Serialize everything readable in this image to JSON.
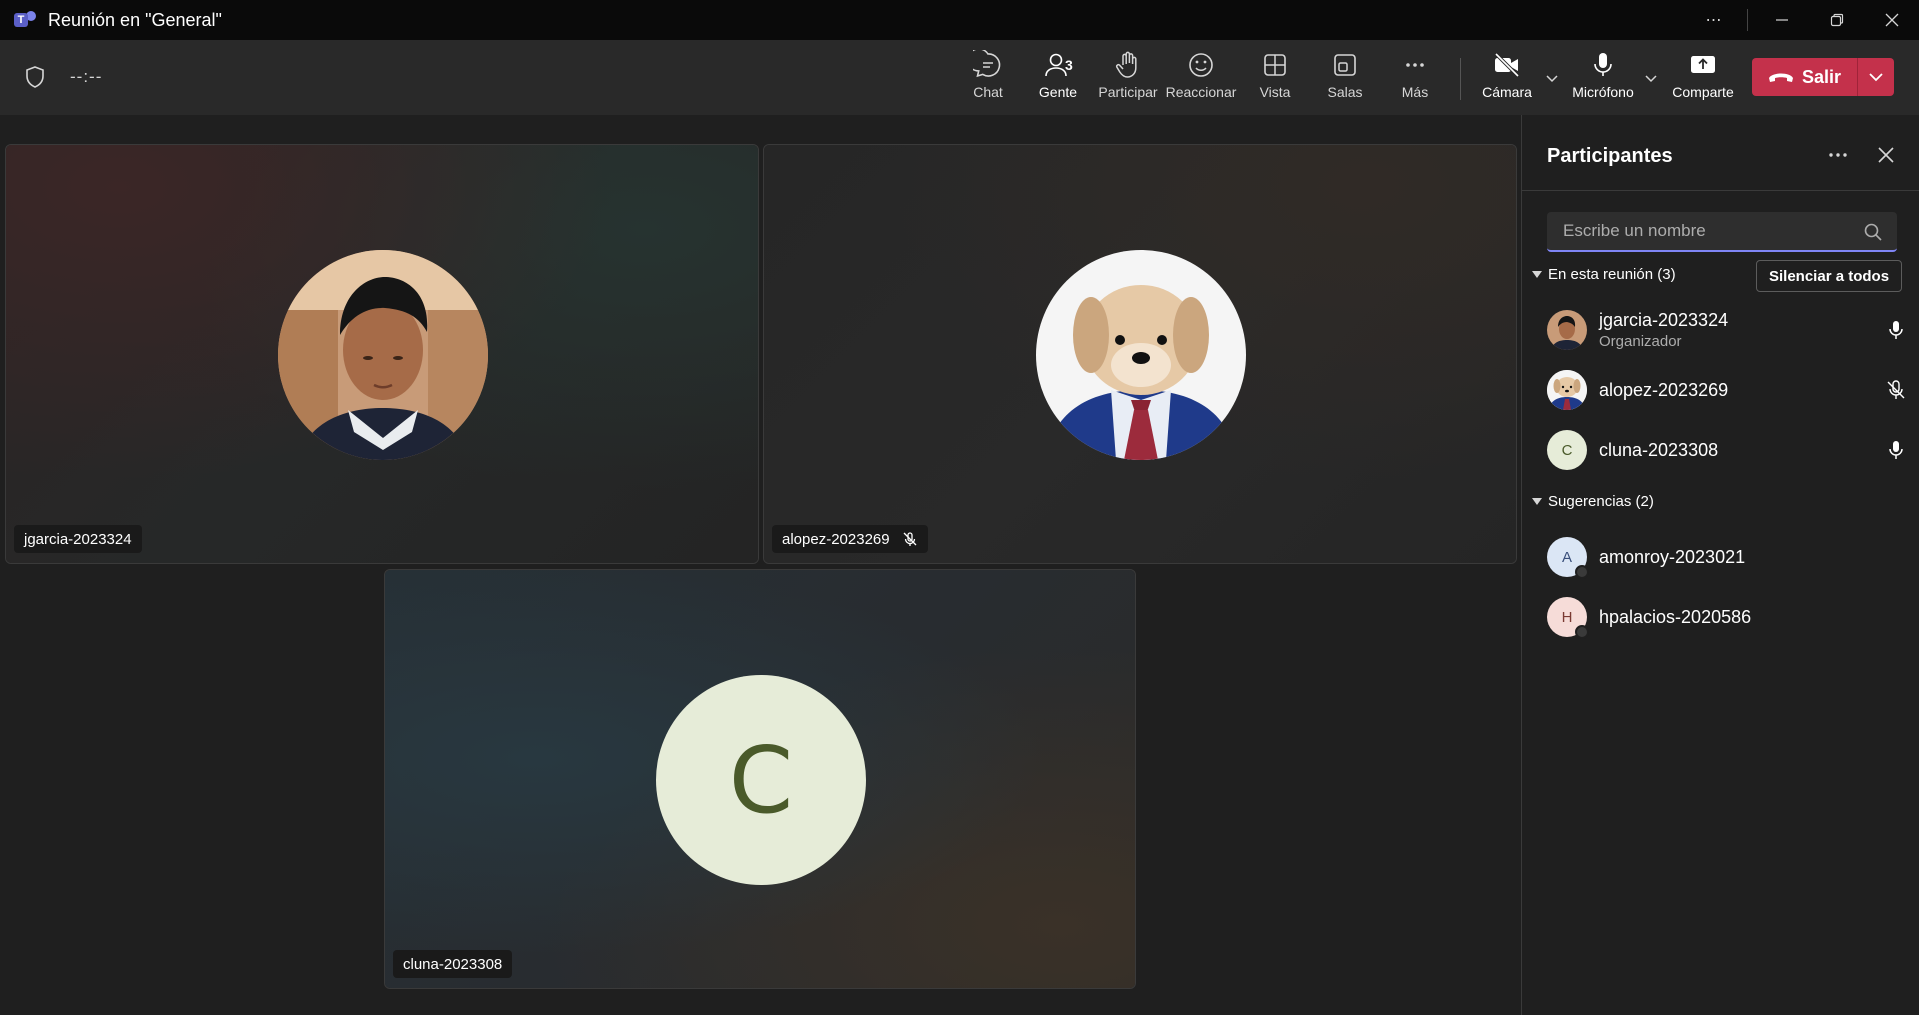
{
  "window": {
    "title": "Reunión en \"General\"",
    "more_icon": "ellipsis-icon",
    "minimize_icon": "minimize-icon",
    "restore_icon": "restore-icon",
    "close_icon": "close-icon"
  },
  "toolbar": {
    "timer": "--:--",
    "chat": "Chat",
    "people": "Gente",
    "people_count": "3",
    "raise": "Participar",
    "react": "Reaccionar",
    "view": "Vista",
    "rooms": "Salas",
    "more": "Más",
    "camera": "Cámara",
    "mic": "Micrófono",
    "share": "Comparte",
    "leave": "Salir",
    "leave_color": "#c4314b",
    "accent": "#7f85f5"
  },
  "stage": {
    "tiles": [
      {
        "name": "jgarcia-2023324",
        "muted": false,
        "avatar": "photo"
      },
      {
        "name": "alopez-2023269",
        "muted": true,
        "avatar": "dog-photo"
      },
      {
        "name": "cluna-2023308",
        "muted": false,
        "avatar": "initial",
        "initial": "C"
      }
    ]
  },
  "panel": {
    "title": "Participantes",
    "search_placeholder": "Escribe un nombre",
    "in_meeting_label": "En esta reunión (3)",
    "mute_all": "Silenciar a todos",
    "in_meeting": [
      {
        "name": "jgarcia-2023324",
        "role": "Organizador",
        "mic": "on"
      },
      {
        "name": "alopez-2023269",
        "role": "",
        "mic": "off"
      },
      {
        "name": "cluna-2023308",
        "role": "",
        "mic": "on",
        "initial": "C"
      }
    ],
    "suggestions_label": "Sugerencias (2)",
    "suggestions": [
      {
        "name": "amonroy-2023021",
        "initial": "A"
      },
      {
        "name": "hpalacios-2020586",
        "initial": "H"
      }
    ]
  }
}
